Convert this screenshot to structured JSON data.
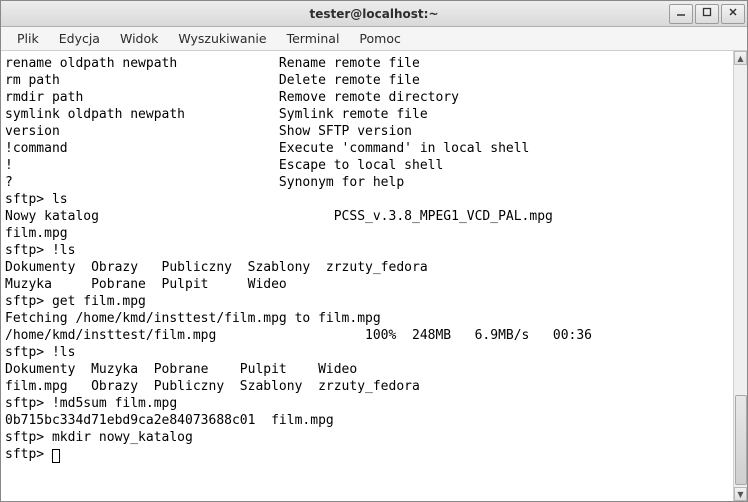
{
  "window": {
    "title": "tester@localhost:~"
  },
  "menubar": {
    "items": [
      "Plik",
      "Edycja",
      "Widok",
      "Wyszukiwanie",
      "Terminal",
      "Pomoc"
    ]
  },
  "terminal": {
    "lines": [
      "rename oldpath newpath             Rename remote file",
      "rm path                            Delete remote file",
      "rmdir path                         Remove remote directory",
      "symlink oldpath newpath            Symlink remote file",
      "version                            Show SFTP version",
      "!command                           Execute 'command' in local shell",
      "!                                  Escape to local shell",
      "?                                  Synonym for help",
      "sftp> ls",
      "Nowy katalog                              PCSS_v.3.8_MPEG1_VCD_PAL.mpg",
      "film.mpg",
      "sftp> !ls",
      "Dokumenty  Obrazy   Publiczny  Szablony  zrzuty_fedora",
      "Muzyka     Pobrane  Pulpit     Wideo",
      "sftp> get film.mpg",
      "Fetching /home/kmd/insttest/film.mpg to film.mpg",
      "/home/kmd/insttest/film.mpg                   100%  248MB   6.9MB/s   00:36",
      "sftp> !ls",
      "Dokumenty  Muzyka  Pobrane    Pulpit    Wideo",
      "film.mpg   Obrazy  Publiczny  Szablony  zrzuty_fedora",
      "sftp> !md5sum film.mpg",
      "0b715bc334d71ebd9ca2e84073688c01  film.mpg",
      "sftp> mkdir nowy_katalog"
    ],
    "prompt": "sftp> "
  }
}
